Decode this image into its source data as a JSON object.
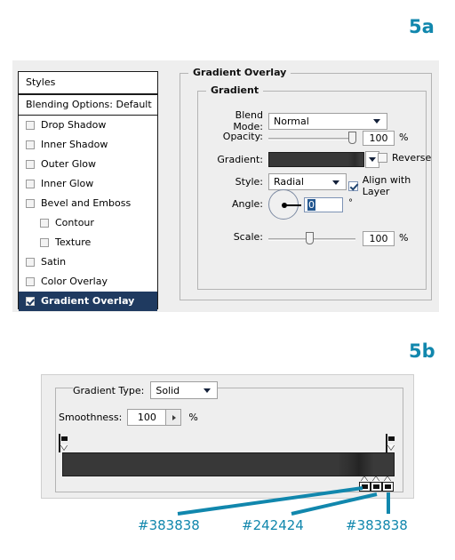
{
  "figure": {
    "label_a": "5a",
    "label_b": "5b",
    "accent_color": "#1187ad"
  },
  "panel_5a": {
    "styles_panel": {
      "header": "Styles",
      "blending_options": "Blending Options: Default",
      "items": [
        {
          "label": "Drop Shadow",
          "checked": false,
          "indent": false
        },
        {
          "label": "Inner Shadow",
          "checked": false,
          "indent": false
        },
        {
          "label": "Outer Glow",
          "checked": false,
          "indent": false
        },
        {
          "label": "Inner Glow",
          "checked": false,
          "indent": false
        },
        {
          "label": "Bevel and Emboss",
          "checked": false,
          "indent": false
        },
        {
          "label": "Contour",
          "checked": false,
          "indent": true
        },
        {
          "label": "Texture",
          "checked": false,
          "indent": true
        },
        {
          "label": "Satin",
          "checked": false,
          "indent": false
        },
        {
          "label": "Color Overlay",
          "checked": false,
          "indent": false
        },
        {
          "label": "Gradient Overlay",
          "checked": true,
          "indent": false,
          "selected": true
        }
      ]
    },
    "group_title": "Gradient Overlay",
    "subgroup_title": "Gradient",
    "fields": {
      "blend_mode_label": "Blend Mode:",
      "blend_mode_value": "Normal",
      "opacity_label": "Opacity:",
      "opacity_value": "100",
      "opacity_unit": "%",
      "gradient_label": "Gradient:",
      "reverse_label": "Reverse",
      "reverse_checked": false,
      "style_label": "Style:",
      "style_value": "Radial",
      "align_label": "Align with Layer",
      "align_checked": true,
      "angle_label": "Angle:",
      "angle_value": "0",
      "angle_unit": "°",
      "scale_label": "Scale:",
      "scale_value": "100",
      "scale_unit": "%"
    }
  },
  "panel_5b": {
    "gradient_type_label": "Gradient Type:",
    "gradient_type_value": "Solid",
    "smoothness_label": "Smoothness:",
    "smoothness_value": "100",
    "smoothness_unit": "%"
  },
  "annotations": {
    "hex_1": "#383838",
    "hex_2": "#242424",
    "hex_3": "#383838"
  }
}
